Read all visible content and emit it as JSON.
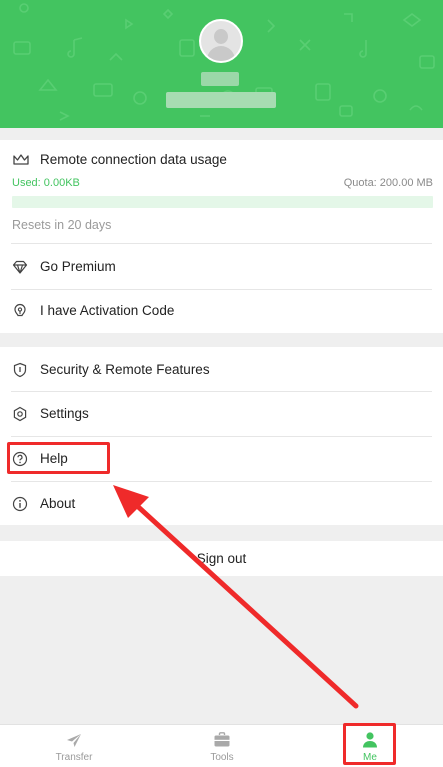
{
  "profile": {
    "avatar": "avatar-placeholder"
  },
  "usage": {
    "title": "Remote connection data usage",
    "used": "Used: 0.00KB",
    "quota": "Quota: 200.00 MB",
    "progress_percent": 0,
    "resets": "Resets in 20 days"
  },
  "account_items": [
    {
      "label": "Go Premium",
      "icon": "diamond-icon"
    },
    {
      "label": "I have Activation Code",
      "icon": "activation-key-icon"
    }
  ],
  "menu_items": [
    {
      "label": "Security & Remote Features",
      "icon": "shield-icon"
    },
    {
      "label": "Settings",
      "icon": "hexagon-settings-icon"
    },
    {
      "label": "Help",
      "icon": "help-circle-icon"
    },
    {
      "label": "About",
      "icon": "info-circle-icon"
    }
  ],
  "signout": {
    "label": "Sign out"
  },
  "tabs": [
    {
      "label": "Transfer",
      "icon": "paper-plane-icon",
      "active": false
    },
    {
      "label": "Tools",
      "icon": "briefcase-icon",
      "active": false
    },
    {
      "label": "Me",
      "icon": "person-icon",
      "active": true
    }
  ],
  "colors": {
    "accent": "#43c460",
    "highlight": "#ef2a2a",
    "background": "#efefef"
  }
}
